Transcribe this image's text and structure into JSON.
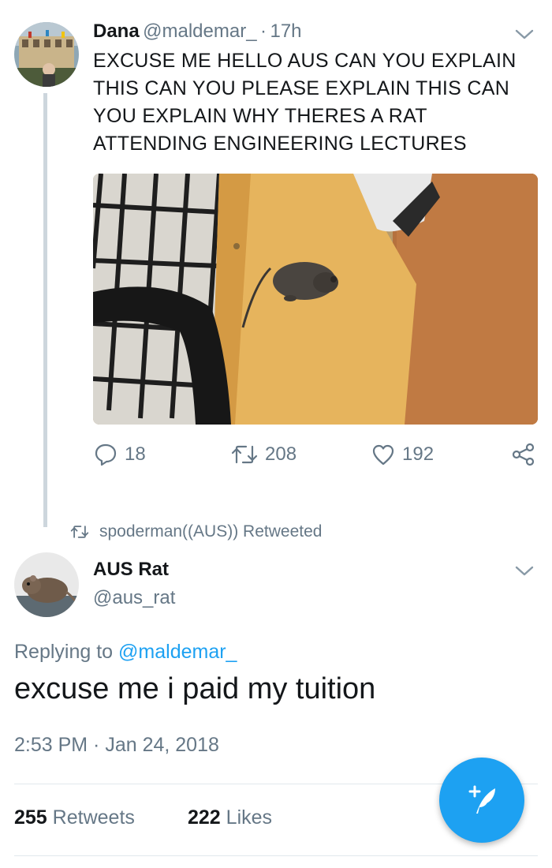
{
  "original_tweet": {
    "author_name": "Dana",
    "author_handle": "@maldemar_",
    "time_sep": "·",
    "time_ago": "17h",
    "text": "EXCUSE ME HELLO AUS CAN YOU EXPLAIN THIS CAN YOU PLEASE EXPLAIN THIS CAN YOU EXPLAIN WHY THERES A RAT ATTENDING ENGINEERING LECTURES",
    "actions": {
      "replies": "18",
      "retweets": "208",
      "likes": "192"
    }
  },
  "retweet_notice": {
    "text": "spoderman((AUS)) Retweeted"
  },
  "reply_tweet": {
    "author_name": "AUS Rat",
    "author_handle": "@aus_rat",
    "replying_prefix": "Replying to",
    "replying_handle": "@maldemar_",
    "text": "excuse me i paid my tuition",
    "timestamp": "2:53 PM · Jan 24, 2018",
    "stats": {
      "retweets_count": "255",
      "retweets_label": "Retweets",
      "likes_count": "222",
      "likes_label": "Likes"
    }
  },
  "icons": {
    "reply": "reply-icon",
    "retweet": "retweet-icon",
    "like": "heart-icon",
    "share": "share-icon",
    "more": "chevron-down-icon",
    "compose": "compose-tweet-icon"
  },
  "colors": {
    "accent": "#1da1f2",
    "muted": "#657786",
    "text": "#14171a",
    "thread_line": "#cdd6dd"
  }
}
